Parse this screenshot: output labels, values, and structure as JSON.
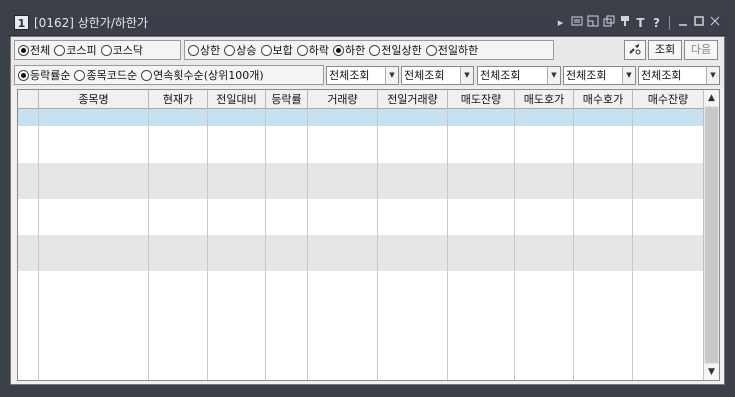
{
  "window": {
    "number": "1",
    "title": "[0162] 상한가/하한가",
    "icons": [
      "play-icon",
      "note-icon",
      "restore-icon",
      "copy-icon",
      "pin-icon",
      "font-icon",
      "help-icon",
      "minimize-icon",
      "maximize-icon",
      "close-icon"
    ]
  },
  "market_filter": {
    "options": [
      "전체",
      "코스피",
      "코스닥"
    ],
    "selected": "전체"
  },
  "price_filter": {
    "options": [
      "상한",
      "상승",
      "보합",
      "하락",
      "하한",
      "전일상한",
      "전일하한"
    ],
    "selected": "하한"
  },
  "toolbar": {
    "settings_icon": "tools-icon",
    "query_label": "조회",
    "next_label": "다음"
  },
  "sort_filter": {
    "options": [
      "등락률순",
      "종목코드순",
      "연속횟수순(상위100개)"
    ],
    "selected": "등락률순"
  },
  "combos": [
    "전체조회",
    "전체조회",
    "전체조회",
    "전체조회",
    "전체조회"
  ],
  "grid": {
    "columns": [
      "",
      "종목명",
      "현재가",
      "전일대비",
      "등락률",
      "거래량",
      "전일거래량",
      "매도잔량",
      "매도호가",
      "매수호가",
      "매수잔량"
    ],
    "rows": []
  },
  "colors": {
    "selected_row": "#c6e2f0",
    "stripe": "#e6e6e6"
  }
}
